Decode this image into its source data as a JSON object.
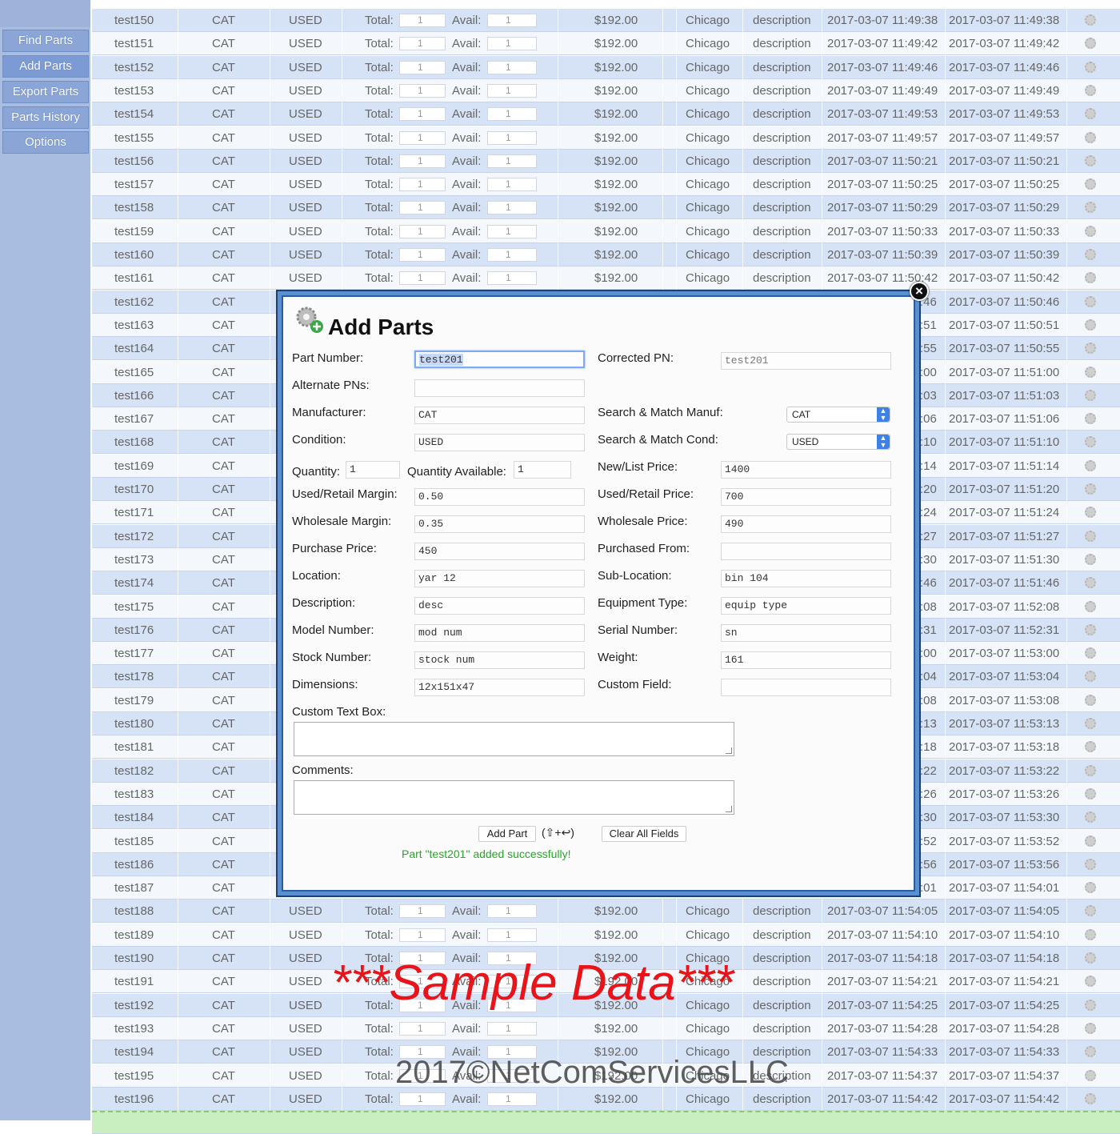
{
  "sidebar": {
    "items": [
      {
        "label": "Find Parts"
      },
      {
        "label": "Add Parts"
      },
      {
        "label": "Export Parts"
      },
      {
        "label": "Parts History"
      },
      {
        "label": "Options"
      }
    ]
  },
  "table": {
    "rows": [
      {
        "pn": "test150",
        "manuf": "CAT",
        "cond": "USED",
        "total": "1",
        "avail": "1",
        "price": "$192.00",
        "loc": "Chicago",
        "desc": "description",
        "created": "2017-03-07 11:49:38",
        "updated": "2017-03-07 11:49:38"
      },
      {
        "pn": "test151",
        "manuf": "CAT",
        "cond": "USED",
        "total": "1",
        "avail": "1",
        "price": "$192.00",
        "loc": "Chicago",
        "desc": "description",
        "created": "2017-03-07 11:49:42",
        "updated": "2017-03-07 11:49:42"
      },
      {
        "pn": "test152",
        "manuf": "CAT",
        "cond": "USED",
        "total": "1",
        "avail": "1",
        "price": "$192.00",
        "loc": "Chicago",
        "desc": "description",
        "created": "2017-03-07 11:49:46",
        "updated": "2017-03-07 11:49:46"
      },
      {
        "pn": "test153",
        "manuf": "CAT",
        "cond": "USED",
        "total": "1",
        "avail": "1",
        "price": "$192.00",
        "loc": "Chicago",
        "desc": "description",
        "created": "2017-03-07 11:49:49",
        "updated": "2017-03-07 11:49:49"
      },
      {
        "pn": "test154",
        "manuf": "CAT",
        "cond": "USED",
        "total": "1",
        "avail": "1",
        "price": "$192.00",
        "loc": "Chicago",
        "desc": "description",
        "created": "2017-03-07 11:49:53",
        "updated": "2017-03-07 11:49:53"
      },
      {
        "pn": "test155",
        "manuf": "CAT",
        "cond": "USED",
        "total": "1",
        "avail": "1",
        "price": "$192.00",
        "loc": "Chicago",
        "desc": "description",
        "created": "2017-03-07 11:49:57",
        "updated": "2017-03-07 11:49:57"
      },
      {
        "pn": "test156",
        "manuf": "CAT",
        "cond": "USED",
        "total": "1",
        "avail": "1",
        "price": "$192.00",
        "loc": "Chicago",
        "desc": "description",
        "created": "2017-03-07 11:50:21",
        "updated": "2017-03-07 11:50:21"
      },
      {
        "pn": "test157",
        "manuf": "CAT",
        "cond": "USED",
        "total": "1",
        "avail": "1",
        "price": "$192.00",
        "loc": "Chicago",
        "desc": "description",
        "created": "2017-03-07 11:50:25",
        "updated": "2017-03-07 11:50:25"
      },
      {
        "pn": "test158",
        "manuf": "CAT",
        "cond": "USED",
        "total": "1",
        "avail": "1",
        "price": "$192.00",
        "loc": "Chicago",
        "desc": "description",
        "created": "2017-03-07 11:50:29",
        "updated": "2017-03-07 11:50:29"
      },
      {
        "pn": "test159",
        "manuf": "CAT",
        "cond": "USED",
        "total": "1",
        "avail": "1",
        "price": "$192.00",
        "loc": "Chicago",
        "desc": "description",
        "created": "2017-03-07 11:50:33",
        "updated": "2017-03-07 11:50:33"
      },
      {
        "pn": "test160",
        "manuf": "CAT",
        "cond": "USED",
        "total": "1",
        "avail": "1",
        "price": "$192.00",
        "loc": "Chicago",
        "desc": "description",
        "created": "2017-03-07 11:50:39",
        "updated": "2017-03-07 11:50:39"
      },
      {
        "pn": "test161",
        "manuf": "CAT",
        "cond": "USED",
        "total": "1",
        "avail": "1",
        "price": "$192.00",
        "loc": "Chicago",
        "desc": "description",
        "created": "2017-03-07 11:50:42",
        "updated": "2017-03-07 11:50:42"
      },
      {
        "pn": "test162",
        "manuf": "CAT",
        "created_tail": ":46",
        "updated": "2017-03-07 11:50:46"
      },
      {
        "pn": "test163",
        "manuf": "CAT",
        "created_tail": ":51",
        "updated": "2017-03-07 11:50:51"
      },
      {
        "pn": "test164",
        "manuf": "CAT",
        "created_tail": ":55",
        "updated": "2017-03-07 11:50:55"
      },
      {
        "pn": "test165",
        "manuf": "CAT",
        "created_tail": ":00",
        "updated": "2017-03-07 11:51:00"
      },
      {
        "pn": "test166",
        "manuf": "CAT",
        "created_tail": ":03",
        "updated": "2017-03-07 11:51:03"
      },
      {
        "pn": "test167",
        "manuf": "CAT",
        "created_tail": ":06",
        "updated": "2017-03-07 11:51:06"
      },
      {
        "pn": "test168",
        "manuf": "CAT",
        "created_tail": ":10",
        "updated": "2017-03-07 11:51:10"
      },
      {
        "pn": "test169",
        "manuf": "CAT",
        "created_tail": ":14",
        "updated": "2017-03-07 11:51:14"
      },
      {
        "pn": "test170",
        "manuf": "CAT",
        "created_tail": ":20",
        "updated": "2017-03-07 11:51:20"
      },
      {
        "pn": "test171",
        "manuf": "CAT",
        "created_tail": ":24",
        "updated": "2017-03-07 11:51:24"
      },
      {
        "pn": "test172",
        "manuf": "CAT",
        "created_tail": ":27",
        "updated": "2017-03-07 11:51:27"
      },
      {
        "pn": "test173",
        "manuf": "CAT",
        "created_tail": ":30",
        "updated": "2017-03-07 11:51:30"
      },
      {
        "pn": "test174",
        "manuf": "CAT",
        "created_tail": ":46",
        "updated": "2017-03-07 11:51:46"
      },
      {
        "pn": "test175",
        "manuf": "CAT",
        "created_tail": ":08",
        "updated": "2017-03-07 11:52:08"
      },
      {
        "pn": "test176",
        "manuf": "CAT",
        "created_tail": ":31",
        "updated": "2017-03-07 11:52:31"
      },
      {
        "pn": "test177",
        "manuf": "CAT",
        "created_tail": ":00",
        "updated": "2017-03-07 11:53:00"
      },
      {
        "pn": "test178",
        "manuf": "CAT",
        "created_tail": ":04",
        "updated": "2017-03-07 11:53:04"
      },
      {
        "pn": "test179",
        "manuf": "CAT",
        "created_tail": ":08",
        "updated": "2017-03-07 11:53:08"
      },
      {
        "pn": "test180",
        "manuf": "CAT",
        "created_tail": ":13",
        "updated": "2017-03-07 11:53:13"
      },
      {
        "pn": "test181",
        "manuf": "CAT",
        "created_tail": ":18",
        "updated": "2017-03-07 11:53:18"
      },
      {
        "pn": "test182",
        "manuf": "CAT",
        "created_tail": ":22",
        "updated": "2017-03-07 11:53:22"
      },
      {
        "pn": "test183",
        "manuf": "CAT",
        "created_tail": ":26",
        "updated": "2017-03-07 11:53:26"
      },
      {
        "pn": "test184",
        "manuf": "CAT",
        "created_tail": ":30",
        "updated": "2017-03-07 11:53:30"
      },
      {
        "pn": "test185",
        "manuf": "CAT",
        "created_tail": ":52",
        "updated": "2017-03-07 11:53:52"
      },
      {
        "pn": "test186",
        "manuf": "CAT",
        "created_tail": ":56",
        "updated": "2017-03-07 11:53:56"
      },
      {
        "pn": "test187",
        "manuf": "CAT",
        "created_tail": ":01",
        "updated": "2017-03-07 11:54:01"
      },
      {
        "pn": "test188",
        "manuf": "CAT",
        "cond": "USED",
        "total": "1",
        "avail": "1",
        "price": "$192.00",
        "loc": "Chicago",
        "desc": "description",
        "created": "2017-03-07 11:54:05",
        "updated": "2017-03-07 11:54:05"
      },
      {
        "pn": "test189",
        "manuf": "CAT",
        "cond": "USED",
        "total": "1",
        "avail": "1",
        "price": "$192.00",
        "loc": "Chicago",
        "desc": "description",
        "created": "2017-03-07 11:54:10",
        "updated": "2017-03-07 11:54:10"
      },
      {
        "pn": "test190",
        "manuf": "CAT",
        "cond": "USED",
        "total": "1",
        "avail": "1",
        "price": "$192.00",
        "loc": "Chicago",
        "desc": "description",
        "created": "2017-03-07 11:54:18",
        "updated": "2017-03-07 11:54:18"
      },
      {
        "pn": "test191",
        "manuf": "CAT",
        "cond": "USED",
        "total": "1",
        "avail": "1",
        "price": "$192.00",
        "loc": "Chicago",
        "desc": "description",
        "created": "2017-03-07 11:54:21",
        "updated": "2017-03-07 11:54:21"
      },
      {
        "pn": "test192",
        "manuf": "CAT",
        "cond": "USED",
        "total": "1",
        "avail": "1",
        "price": "$192.00",
        "loc": "Chicago",
        "desc": "description",
        "created": "2017-03-07 11:54:25",
        "updated": "2017-03-07 11:54:25"
      },
      {
        "pn": "test193",
        "manuf": "CAT",
        "cond": "USED",
        "total": "1",
        "avail": "1",
        "price": "$192.00",
        "loc": "Chicago",
        "desc": "description",
        "created": "2017-03-07 11:54:28",
        "updated": "2017-03-07 11:54:28"
      },
      {
        "pn": "test194",
        "manuf": "CAT",
        "cond": "USED",
        "total": "1",
        "avail": "1",
        "price": "$192.00",
        "loc": "Chicago",
        "desc": "description",
        "created": "2017-03-07 11:54:33",
        "updated": "2017-03-07 11:54:33"
      },
      {
        "pn": "test195",
        "manuf": "CAT",
        "cond": "USED",
        "total": "1",
        "avail": "1",
        "price": "$192.00",
        "loc": "Chicago",
        "desc": "description",
        "created": "2017-03-07 11:54:37",
        "updated": "2017-03-07 11:54:37"
      },
      {
        "pn": "test196",
        "manuf": "CAT",
        "cond": "USED",
        "total": "1",
        "avail": "1",
        "price": "$192.00",
        "loc": "Chicago",
        "desc": "description",
        "created": "2017-03-07 11:54:42",
        "updated": "2017-03-07 11:54:42"
      }
    ],
    "total_label": "Total:",
    "avail_label": "Avail:"
  },
  "modal": {
    "title": "Add Parts",
    "close": "×",
    "part_number_label": "Part Number:",
    "part_number": "test201",
    "corrected_pn_label": "Corrected PN:",
    "corrected_pn": "test201",
    "alternate_pns_label": "Alternate PNs:",
    "alternate_pns": "",
    "manufacturer_label": "Manufacturer:",
    "manufacturer": "CAT",
    "match_manuf_label": "Search & Match Manuf:",
    "match_manuf": "CAT",
    "condition_label": "Condition:",
    "condition": "USED",
    "match_cond_label": "Search & Match Cond:",
    "match_cond": "USED",
    "quantity_label": "Quantity:",
    "quantity": "1",
    "quantity_available_label": "Quantity Available:",
    "quantity_available": "1",
    "new_list_price_label": "New/List Price:",
    "new_list_price": "1400",
    "used_retail_margin_label": "Used/Retail Margin:",
    "used_retail_margin": "0.50",
    "used_retail_price_label": "Used/Retail Price:",
    "used_retail_price": "700",
    "wholesale_margin_label": "Wholesale Margin:",
    "wholesale_margin": "0.35",
    "wholesale_price_label": "Wholesale Price:",
    "wholesale_price": "490",
    "purchase_price_label": "Purchase Price:",
    "purchase_price": "450",
    "purchased_from_label": "Purchased From:",
    "purchased_from": "",
    "location_label": "Location:",
    "location": "yar 12",
    "sub_location_label": "Sub-Location:",
    "sub_location": "bin 104",
    "description_label": "Description:",
    "description": "desc",
    "equipment_type_label": "Equipment Type:",
    "equipment_type": "equip type",
    "model_number_label": "Model Number:",
    "model_number": "mod num",
    "serial_number_label": "Serial Number:",
    "serial_number": "sn",
    "stock_number_label": "Stock Number:",
    "stock_number": "stock num",
    "weight_label": "Weight:",
    "weight": "161",
    "dimensions_label": "Dimensions:",
    "dimensions": "12x151x47",
    "custom_field_label": "Custom Field:",
    "custom_field": "",
    "custom_text_box_label": "Custom Text Box:",
    "comments_label": "Comments:",
    "add_part_button": "Add Part",
    "shortcut_hint": "(⇧+↩)",
    "clear_all_button": "Clear All Fields",
    "success_message": "Part \"test201\" added successfully!"
  },
  "watermark": {
    "sample": "***Sample Data***",
    "copyright": "2017©NetComServicesLLC"
  },
  "colors": {
    "row_odd": "#d6e2f5",
    "row_even": "#f4f7fb",
    "sidebar": "#a9bde0",
    "success": "#2aa52a",
    "watermark": "#e8141a"
  }
}
